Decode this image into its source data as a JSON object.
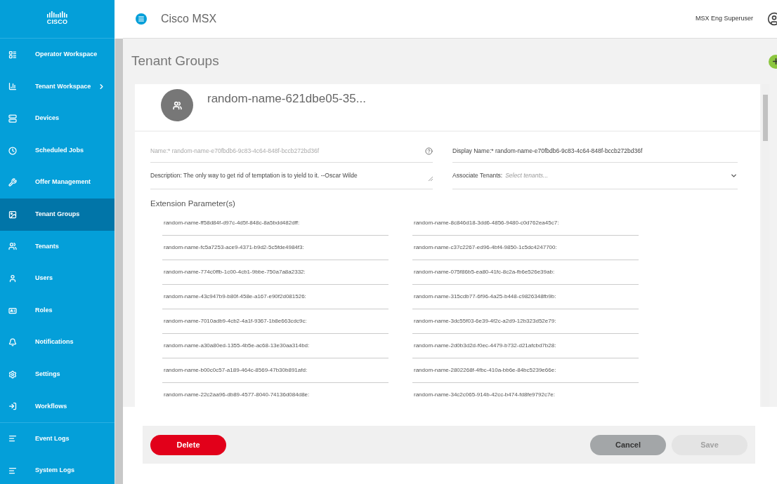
{
  "sidebar": {
    "logo": "CISCO",
    "items": [
      {
        "label": "Operator Workspace",
        "selected": false,
        "has_submenu": false
      },
      {
        "label": "Tenant Workspace",
        "selected": false,
        "has_submenu": true
      },
      {
        "label": "Devices",
        "selected": false,
        "has_submenu": false
      },
      {
        "label": "Scheduled Jobs",
        "selected": false,
        "has_submenu": false
      },
      {
        "label": "Offer Management",
        "selected": false,
        "has_submenu": false
      },
      {
        "label": "Tenant Groups",
        "selected": true,
        "has_submenu": false
      },
      {
        "label": "Tenants",
        "selected": false,
        "has_submenu": false
      },
      {
        "label": "Users",
        "selected": false,
        "has_submenu": false
      },
      {
        "label": "Roles",
        "selected": false,
        "has_submenu": false
      },
      {
        "label": "Notifications",
        "selected": false,
        "has_submenu": false
      },
      {
        "label": "Settings",
        "selected": false,
        "has_submenu": false
      },
      {
        "label": "Workflows",
        "selected": false,
        "has_submenu": false
      },
      {
        "label": "Event Logs",
        "selected": false,
        "has_submenu": false
      },
      {
        "label": "System Logs",
        "selected": false,
        "has_submenu": false
      }
    ]
  },
  "header": {
    "app_title": "Cisco MSX",
    "user": "MSX Eng Superuser"
  },
  "page": {
    "title": "Tenant Groups",
    "group_name": "random-name-621dbe05-35..."
  },
  "form": {
    "name": {
      "label": "Name:*",
      "value": "random-name-e70fbdb6-9c83-4c64-848f-bccb272bd36f",
      "disabled": true
    },
    "display_name": {
      "label": "Display Name:*",
      "value": "random-name-e70fbdb6-9c83-4c64-848f-bccb272bd36f"
    },
    "description": {
      "label": "Description:",
      "value": "The only way to get rid of temptation is to yield to it. --Oscar Wilde"
    },
    "associate_tenants": {
      "label": "Associate Tenants:",
      "placeholder": "Select tenants..."
    },
    "extension_title": "Extension Parameter(s)",
    "extension_parameters": [
      "random-name-ff58d84f-d97c-4d5f-848c-8a5bdd482dff:",
      "random-name-8c846d18-3dd6-4856-9480-c0d762ea45c7:",
      "random-name-fc5a7253-ace9-4371-b9d2-5c5fde4984f3:",
      "random-name-c37c2267-ed96-4bf4-9850-1c5dc4247700:",
      "random-name-774c0ffb-1c00-4cb1-9bbe-750a7a8a2332:",
      "random-name-075f86b5-ea80-41fc-8c2a-fb6e526e39ab:",
      "random-name-43c947b9-b80f-458e-a167-e90f2d081526:",
      "random-name-315cdb77-6f96-4a25-b448-c9826348fb9b:",
      "random-name-7010adb9-4cb2-4a1f-9367-1b8e663cdc9c:",
      "random-name-3dc55f03-6e39-4f2c-a2d9-12b323d52e79:",
      "random-name-a30a80ed-1355-4b5e-ac68-13e30aa314bd:",
      "random-name-2d0b3d2d-f0ec-4479-b732-d21afcbd7b28:",
      "random-name-b00c0c57-a189-464c-8569-47b30b891afd:",
      "random-name-2802268f-4fbc-410a-bb6e-84bc5239e66e:",
      "random-name-22c2aa96-db89-4577-8040-74136d084d8e:",
      "random-name-34c2c065-914b-42cc-b474-fd8fe9792c7e:"
    ]
  },
  "buttons": [
    {
      "label": "Delete",
      "kind": "danger",
      "disabled": false
    },
    {
      "label": "Cancel",
      "kind": "secondary",
      "disabled": false
    },
    {
      "label": "Save",
      "kind": "primary",
      "disabled": true
    }
  ]
}
